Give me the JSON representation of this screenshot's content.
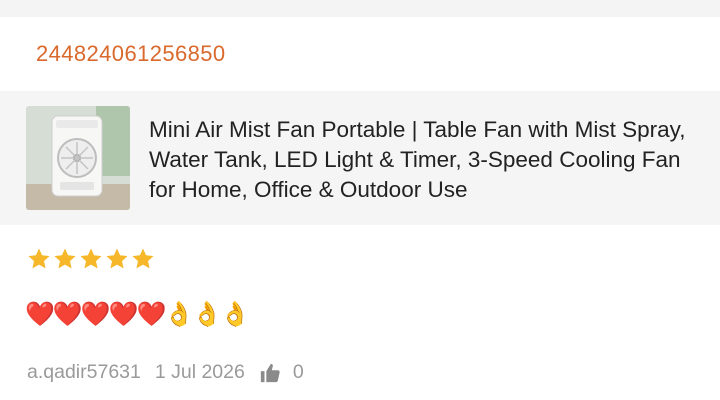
{
  "order": {
    "id": "244824061256850"
  },
  "product": {
    "image_alt": "mini-air-mist-fan",
    "title": "Mini Air Mist Fan Portable | Table Fan with Mist Spray, Water Tank, LED Light & Timer, 3-Speed Cooling Fan for Home, Office & Outdoor Use"
  },
  "review": {
    "rating": 5,
    "rating_max": 5,
    "star_color": "#f6b72b",
    "comment": "❤️❤️❤️❤️❤️👌👌👌",
    "reviewer": "a.qadir57631",
    "date": "1 Jul 2026",
    "like_icon": "thumbs-up-icon",
    "likes": "0"
  },
  "colors": {
    "accent": "#d9692d",
    "muted": "#9a9a9a"
  }
}
